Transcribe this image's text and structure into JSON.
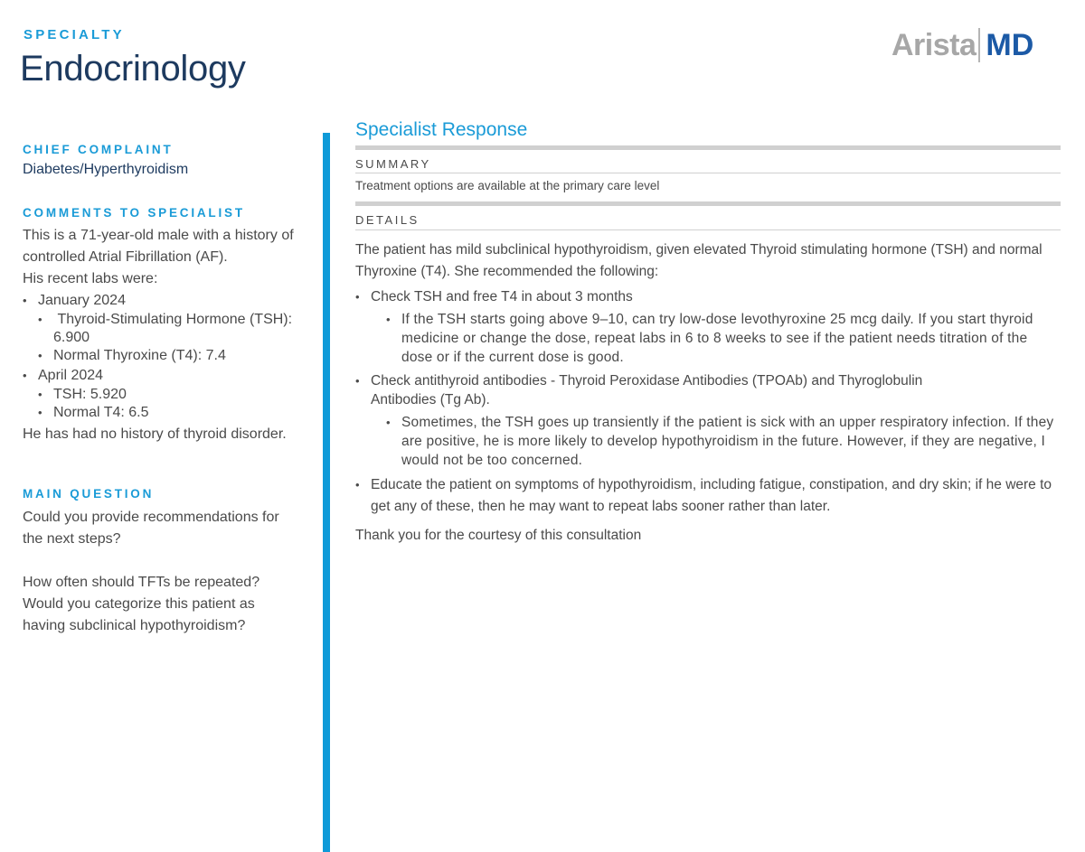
{
  "header": {
    "specialty_label": "SPECIALTY",
    "specialty_name": "Endocrinology",
    "logo": {
      "left": "Arista",
      "right": "MD"
    }
  },
  "colors": {
    "accent": "#1a9bd7",
    "navy": "#1d3a5f",
    "logo_gray": "#a7a7a7",
    "logo_blue": "#1c5aa6",
    "bar": "#0e9ad8"
  },
  "left": {
    "chief_complaint": {
      "heading": "CHIEF COMPLAINT",
      "value": "Diabetes/Hyperthyroidism"
    },
    "comments": {
      "heading": "COMMENTS TO SPECIALIST",
      "intro": "This is a 71-year-old male with a history of controlled Atrial Fibrillation (AF).",
      "labs_intro": "His recent labs were:",
      "labs": [
        {
          "date": "January 2024",
          "items": [
            "Thyroid-Stimulating Hormone (TSH): 6.900",
            "Normal Thyroxine (T4): 7.4"
          ]
        },
        {
          "date": "April 2024",
          "items": [
            "TSH: 5.920",
            "Normal T4: 6.5"
          ]
        }
      ],
      "closing": "He has had no history of thyroid disorder."
    },
    "main_question": {
      "heading": "MAIN QUESTION",
      "q1": "Could you provide recommendations for the next steps?",
      "q2": "How often should TFTs be repeated?",
      "q3": "Would you categorize this patient as having subclinical hypothyroidism?"
    }
  },
  "response": {
    "title": "Specialist Response",
    "summary_heading": "SUMMARY",
    "summary": "Treatment options are available at the primary care level",
    "details_heading": "DETAILS",
    "intro": "The patient has mild subclinical hypothyroidism, given elevated Thyroid stimulating hormone (TSH) and normal Thyroxine (T4). She recommended the following:",
    "items": [
      {
        "text": "Check TSH and free T4 in about 3 months",
        "sub": "If the TSH starts going above 9–10, can try low-dose levothyroxine 25 mcg daily.  If you start thyroid medicine or change the dose, repeat labs in 6 to 8 weeks to see if the patient needs titration of the dose or if the current dose is good."
      },
      {
        "text": "Check antithyroid antibodies - Thyroid Peroxidase Antibodies (TPOAb) and Thyroglobulin Antibodies (Tg Ab).",
        "sub": "Sometimes, the TSH goes up transiently if the patient is sick with an upper respiratory infection. If they are positive, he is more likely to develop hypothyroidism in the future. However, if they are negative, I would not be too concerned."
      },
      {
        "text": "Educate the patient on symptoms of hypothyroidism, including fatigue, constipation, and dry skin; if he were to get any of these, then he may want to repeat labs sooner rather than later."
      }
    ],
    "thanks": "Thank you for the courtesy of this consultation"
  }
}
